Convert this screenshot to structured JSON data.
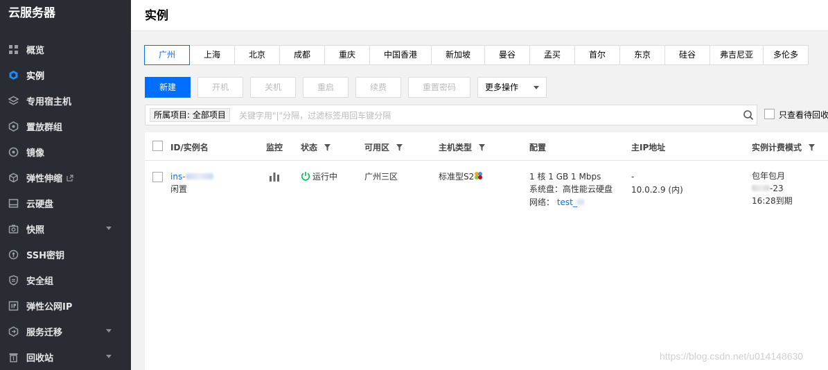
{
  "sidebar": {
    "title": "云服务器",
    "items": [
      {
        "label": "概览",
        "icon": "grid-icon"
      },
      {
        "label": "实例",
        "icon": "cube-icon",
        "active": true
      },
      {
        "label": "专用宿主机",
        "icon": "layers-icon"
      },
      {
        "label": "置放群组",
        "icon": "group-icon"
      },
      {
        "label": "镜像",
        "icon": "disc-icon"
      },
      {
        "label": "弹性伸缩",
        "icon": "box-icon",
        "external": true
      },
      {
        "label": "云硬盘",
        "icon": "drive-icon"
      },
      {
        "label": "快照",
        "icon": "camera-icon",
        "expandable": true
      },
      {
        "label": "SSH密钥",
        "icon": "key-icon"
      },
      {
        "label": "安全组",
        "icon": "shield-icon"
      },
      {
        "label": "弹性公网IP",
        "icon": "ip-icon"
      },
      {
        "label": "服务迁移",
        "icon": "migrate-icon",
        "expandable": true
      },
      {
        "label": "回收站",
        "icon": "trash-icon",
        "expandable": true
      }
    ]
  },
  "header": {
    "title": "实例"
  },
  "regions": [
    "广州",
    "上海",
    "北京",
    "成都",
    "重庆",
    "中国香港",
    "新加坡",
    "曼谷",
    "孟买",
    "首尔",
    "东京",
    "硅谷",
    "弗吉尼亚",
    "多伦多"
  ],
  "selected_region": "广州",
  "toolbar": {
    "new": "新建",
    "start": "开机",
    "shutdown": "关机",
    "restart": "重启",
    "renew": "续费",
    "reset_password": "重置密码",
    "more": "更多操作"
  },
  "search": {
    "project_tag": "所属项目: 全部项目",
    "placeholder": "关键字用\"|\"分隔，过滤标签用回车键分隔",
    "pending_label": "只查看待回收"
  },
  "table": {
    "headers": {
      "id": "ID/实例名",
      "monitor": "监控",
      "status": "状态",
      "zone": "可用区",
      "type": "主机类型",
      "config": "配置",
      "ip": "主IP地址",
      "billing": "实例计费模式"
    },
    "rows": [
      {
        "id_prefix": "ins-",
        "name": "闲置",
        "status": "运行中",
        "zone": "广州三区",
        "type": "标准型S2",
        "config_line1": "1 核 1 GB 1 Mbps",
        "config_line2": "系统盘：高性能云硬盘",
        "network_label": "网络：",
        "network_value": "test_",
        "ip_public": "-",
        "ip_private": "10.0.2.9 (内)",
        "billing_mode": "包年包月",
        "expire_date_suffix": "-23",
        "expire_time": "16:28到期"
      }
    ]
  },
  "watermark": "https://blog.csdn.net/u014148630",
  "colors": {
    "primary": "#006eff",
    "sidebar_bg": "#292d33",
    "running": "#0abf5b"
  }
}
